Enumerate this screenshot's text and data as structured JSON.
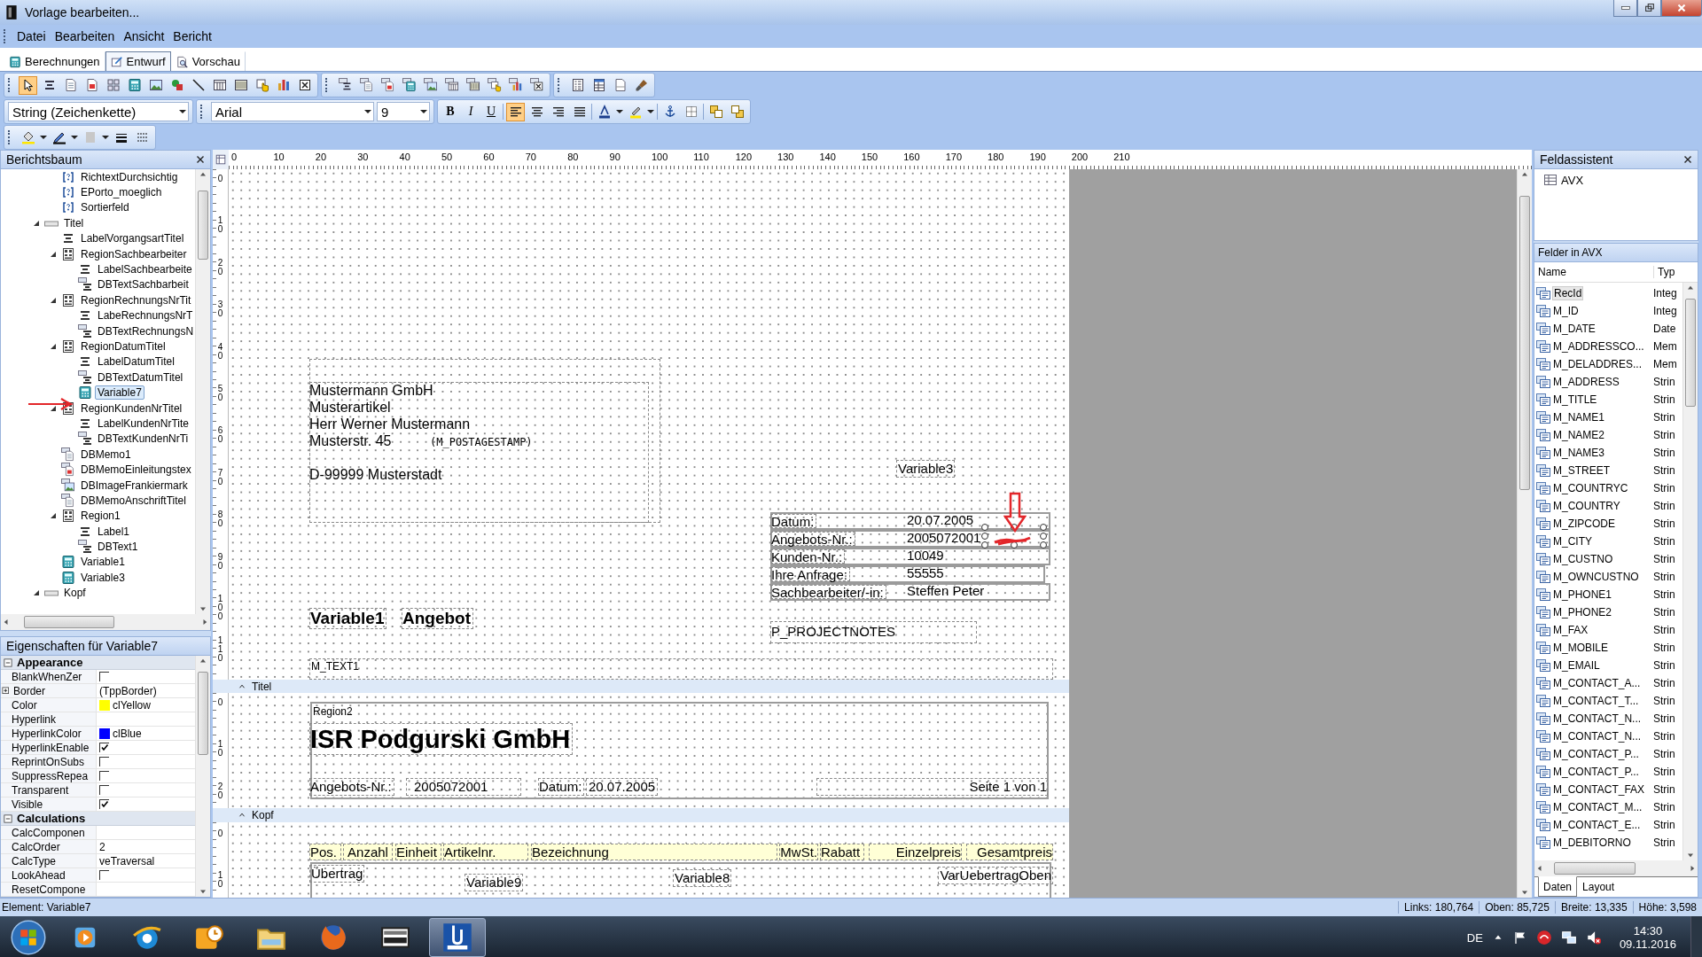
{
  "window": {
    "title": "Vorlage bearbeiten..."
  },
  "menu": [
    "Datei",
    "Bearbeiten",
    "Ansicht",
    "Bericht"
  ],
  "tabs": [
    {
      "label": "Berechnungen",
      "kind": "calc",
      "selected": false
    },
    {
      "label": "Entwurf",
      "kind": "design",
      "selected": true
    },
    {
      "label": "Vorschau",
      "kind": "preview",
      "selected": false
    }
  ],
  "toolbar": {
    "tools": [
      {
        "kind": "pointer",
        "selected": true
      },
      {
        "kind": "label",
        "selected": false
      },
      {
        "kind": "memo",
        "selected": false
      },
      {
        "kind": "richtext",
        "selected": false
      },
      {
        "kind": "sysvar",
        "selected": false
      },
      {
        "kind": "variable",
        "selected": false
      },
      {
        "kind": "image",
        "selected": false
      },
      {
        "kind": "shape",
        "selected": false
      },
      {
        "kind": "line",
        "selected": false
      },
      {
        "kind": "region",
        "selected": false
      },
      {
        "kind": "barcode",
        "selected": false
      },
      {
        "kind": "hand",
        "selected": false
      },
      {
        "kind": "chart",
        "selected": false
      },
      {
        "kind": "subreport",
        "selected": false
      },
      {
        "kind": "db-label",
        "selected": false
      },
      {
        "kind": "db-memo",
        "selected": false
      },
      {
        "kind": "db-richtext",
        "selected": false
      },
      {
        "kind": "db-variable",
        "selected": false
      },
      {
        "kind": "db-image",
        "selected": false
      },
      {
        "kind": "db-region",
        "selected": false
      },
      {
        "kind": "db-barcode",
        "selected": false
      },
      {
        "kind": "db-hand",
        "selected": false
      },
      {
        "kind": "db-chart",
        "selected": false
      },
      {
        "kind": "db-subreport",
        "selected": false
      },
      {
        "kind": "list",
        "selected": false
      },
      {
        "kind": "table",
        "selected": false
      },
      {
        "kind": "page",
        "selected": false
      },
      {
        "kind": "brush",
        "selected": false
      }
    ]
  },
  "format_bar": {
    "field_type": "String (Zeichenkette)",
    "font": "Arial",
    "font_size": "9",
    "styles": [
      {
        "label": "B",
        "kind": "bold"
      },
      {
        "label": "I",
        "kind": "italic"
      },
      {
        "label": "U",
        "kind": "underline"
      }
    ],
    "align": [
      {
        "kind": "left",
        "selected": true
      },
      {
        "kind": "center",
        "selected": false
      },
      {
        "kind": "right",
        "selected": false
      },
      {
        "kind": "justify",
        "selected": false
      }
    ]
  },
  "report_tree": {
    "title": "Berichtsbaum",
    "continued": [
      {
        "label": "RichtextDurchsichtig",
        "kind": "field",
        "selected": false
      },
      {
        "label": "EPorto_moeglich",
        "kind": "field",
        "selected": false
      },
      {
        "label": "Sortierfeld",
        "kind": "field",
        "selected": false
      }
    ],
    "nodes": [
      {
        "label": "Titel",
        "kind": "band",
        "selected": false,
        "expanded": true,
        "children": [
          {
            "label": "LabelVorgangsartTitel",
            "kind": "label",
            "selected": false
          },
          {
            "label": "RegionSachbearbeiter",
            "kind": "region",
            "selected": false,
            "expanded": true,
            "children": [
              {
                "label": "LabelSachbearbeite",
                "kind": "label",
                "selected": false
              },
              {
                "label": "DBTextSachbarbeit",
                "kind": "dbtext",
                "selected": false
              }
            ]
          },
          {
            "label": "RegionRechnungsNrTit",
            "kind": "region",
            "selected": false,
            "expanded": true,
            "children": [
              {
                "label": "LabeRechnungsNrT",
                "kind": "label",
                "selected": false
              },
              {
                "label": "DBTextRechnungsN",
                "kind": "dbtext",
                "selected": false
              }
            ]
          },
          {
            "label": "RegionDatumTitel",
            "kind": "region",
            "selected": false,
            "expanded": true,
            "children": [
              {
                "label": "LabelDatumTitel",
                "kind": "label",
                "selected": false
              },
              {
                "label": "DBTextDatumTitel",
                "kind": "dbtext",
                "selected": false
              },
              {
                "label": "Variable7",
                "kind": "variable",
                "selected": true
              }
            ]
          },
          {
            "label": "RegionKundenNrTitel",
            "kind": "region",
            "selected": false,
            "expanded": true,
            "children": [
              {
                "label": "LabelKundenNrTite",
                "kind": "label",
                "selected": false
              },
              {
                "label": "DBTextKundenNrTi",
                "kind": "dbtext",
                "selected": false
              }
            ]
          },
          {
            "label": "DBMemo1",
            "kind": "dbmemo",
            "selected": false
          },
          {
            "label": "DBMemoEinleitungstex",
            "kind": "dbrich",
            "selected": false
          },
          {
            "label": "DBImageFrankiermark",
            "kind": "dbimage",
            "selected": false
          },
          {
            "label": "DBMemoAnschriftTitel",
            "kind": "dbmemo",
            "selected": false
          },
          {
            "label": "Region1",
            "kind": "region",
            "selected": false,
            "expanded": true,
            "children": [
              {
                "label": "Label1",
                "kind": "label",
                "selected": false
              },
              {
                "label": "DBText1",
                "kind": "dbtext",
                "selected": false
              }
            ]
          },
          {
            "label": "Variable1",
            "kind": "variable",
            "selected": false
          },
          {
            "label": "Variable3",
            "kind": "variable",
            "selected": false
          }
        ]
      },
      {
        "label": "Kopf",
        "kind": "band",
        "selected": false,
        "expanded": true
      }
    ]
  },
  "properties": {
    "title": "Eigenschaften für Variable7",
    "categories": [
      {
        "name": "Appearance",
        "expanded": true,
        "rows": [
          {
            "name": "BlankWhenZer",
            "kind": "checkbox",
            "checked": false
          },
          {
            "name": "Border",
            "kind": "text",
            "value": "(TppBorder)",
            "expanded": false
          },
          {
            "name": "Color",
            "kind": "color",
            "value": "clYellow",
            "color": "#ffff00"
          },
          {
            "name": "Hyperlink",
            "kind": "text"
          },
          {
            "name": "HyperlinkColor",
            "kind": "color",
            "value": "clBlue",
            "color": "#0000ff"
          },
          {
            "name": "HyperlinkEnable",
            "kind": "checkbox",
            "checked": true
          },
          {
            "name": "ReprintOnSubs",
            "kind": "checkbox",
            "checked": false
          },
          {
            "name": "SuppressRepea",
            "kind": "checkbox",
            "checked": false
          },
          {
            "name": "Transparent",
            "kind": "checkbox",
            "checked": false
          },
          {
            "name": "Visible",
            "kind": "checkbox",
            "checked": true
          }
        ]
      },
      {
        "name": "Calculations",
        "expanded": true,
        "rows": [
          {
            "name": "CalcComponen",
            "kind": "text"
          },
          {
            "name": "CalcOrder",
            "kind": "text",
            "value": "2"
          },
          {
            "name": "CalcType",
            "kind": "text",
            "value": "veTraversal"
          },
          {
            "name": "LookAhead",
            "kind": "checkbox",
            "checked": false
          },
          {
            "name": "ResetCompone",
            "kind": "text"
          }
        ]
      }
    ]
  },
  "canvas": {
    "ruler": [
      "0",
      "10",
      "20",
      "30",
      "40",
      "50",
      "60",
      "70",
      "80",
      "90",
      "100",
      "110",
      "120",
      "130",
      "140",
      "150",
      "160",
      "170",
      "180",
      "190",
      "200",
      "210"
    ],
    "upper_band": {
      "ruler": [
        "0",
        "10",
        "20",
        "30",
        "40",
        "50",
        "60",
        "70",
        "80",
        "90",
        "100",
        "110"
      ],
      "address_lines": [
        "Mustermann GmbH",
        "Musterartikel",
        "Herr Werner Mustermann",
        "Musterstr. 45",
        "D-99999 Musterstadt"
      ],
      "postage_field": "(M_POSTAGESTAMP)",
      "variable_field": "Variable3",
      "info_rows": [
        {
          "label": "Datum:",
          "value": "20.07.2005"
        },
        {
          "label": "Angebots-Nr.:",
          "value": "2005072001"
        },
        {
          "label": "Kunden-Nr.:",
          "value": "10049"
        },
        {
          "label": "Ihre Anfrage:",
          "value": "55555"
        },
        {
          "label": "Sachbearbeiter/-in:",
          "value": "Steffen Peter"
        }
      ],
      "overlapping_fields": [
        "Variable1",
        "Angebot"
      ],
      "project_notes": "P_PROJECTNOTES",
      "memo_field": "M_TEXT1"
    },
    "title_band": {
      "name": "Titel",
      "ruler": [
        "0",
        "10",
        "20"
      ],
      "region_label": "Region2",
      "company": "ISR Podgurski GmbH",
      "offer_label": "Angebots-Nr.:",
      "offer_number": "2005072001",
      "date_label": "Datum:",
      "date": "20.07.2005",
      "page_info": "Seite 1 von 1"
    },
    "header_band": {
      "name": "Kopf",
      "ruler": [
        "0",
        "10"
      ],
      "columns": [
        {
          "label": "Pos.",
          "kind": "left"
        },
        {
          "label": "Anzahl",
          "kind": "center"
        },
        {
          "label": "Einheit",
          "kind": "left"
        },
        {
          "label": "Artikelnr.",
          "kind": "left"
        },
        {
          "label": "Bezeichnung",
          "kind": "left"
        },
        {
          "label": "MwSt.",
          "kind": "right"
        },
        {
          "label": "Rabatt",
          "kind": "left"
        },
        {
          "label": "Einzelpreis",
          "kind": "right"
        },
        {
          "label": "Gesamtpreis",
          "kind": "right"
        }
      ],
      "row_fields": [
        "Übertrag",
        "Variable9",
        "Variable8",
        "VarUebertragOben"
      ]
    }
  },
  "field_assistant": {
    "title": "Feldassistent",
    "source": "AVX",
    "fields_title": "Felder in AVX",
    "columns": [
      "Name",
      "Typ"
    ],
    "fields": [
      {
        "name": "RecId",
        "type": "Integ",
        "selected": true
      },
      {
        "name": "M_ID",
        "type": "Integ",
        "selected": false
      },
      {
        "name": "M_DATE",
        "type": "Date",
        "selected": false
      },
      {
        "name": "M_ADDRESSCO...",
        "type": "Mem",
        "selected": false
      },
      {
        "name": "M_DELADDRES...",
        "type": "Mem",
        "selected": false
      },
      {
        "name": "M_ADDRESS",
        "type": "Strin",
        "selected": false
      },
      {
        "name": "M_TITLE",
        "type": "Strin",
        "selected": false
      },
      {
        "name": "M_NAME1",
        "type": "Strin",
        "selected": false
      },
      {
        "name": "M_NAME2",
        "type": "Strin",
        "selected": false
      },
      {
        "name": "M_NAME3",
        "type": "Strin",
        "selected": false
      },
      {
        "name": "M_STREET",
        "type": "Strin",
        "selected": false
      },
      {
        "name": "M_COUNTRYC",
        "type": "Strin",
        "selected": false
      },
      {
        "name": "M_COUNTRY",
        "type": "Strin",
        "selected": false
      },
      {
        "name": "M_ZIPCODE",
        "type": "Strin",
        "selected": false
      },
      {
        "name": "M_CITY",
        "type": "Strin",
        "selected": false
      },
      {
        "name": "M_CUSTNO",
        "type": "Strin",
        "selected": false
      },
      {
        "name": "M_OWNCUSTNO",
        "type": "Strin",
        "selected": false
      },
      {
        "name": "M_PHONE1",
        "type": "Strin",
        "selected": false
      },
      {
        "name": "M_PHONE2",
        "type": "Strin",
        "selected": false
      },
      {
        "name": "M_FAX",
        "type": "Strin",
        "selected": false
      },
      {
        "name": "M_MOBILE",
        "type": "Strin",
        "selected": false
      },
      {
        "name": "M_EMAIL",
        "type": "Strin",
        "selected": false
      },
      {
        "name": "M_CONTACT_A...",
        "type": "Strin",
        "selected": false
      },
      {
        "name": "M_CONTACT_T...",
        "type": "Strin",
        "selected": false
      },
      {
        "name": "M_CONTACT_N...",
        "type": "Strin",
        "selected": false
      },
      {
        "name": "M_CONTACT_N...",
        "type": "Strin",
        "selected": false
      },
      {
        "name": "M_CONTACT_P...",
        "type": "Strin",
        "selected": false
      },
      {
        "name": "M_CONTACT_P...",
        "type": "Strin",
        "selected": false
      },
      {
        "name": "M_CONTACT_FAX",
        "type": "Strin",
        "selected": false
      },
      {
        "name": "M_CONTACT_M...",
        "type": "Strin",
        "selected": false
      },
      {
        "name": "M_CONTACT_E...",
        "type": "Strin",
        "selected": false
      },
      {
        "name": "M_DEBITORNO",
        "type": "Strin",
        "selected": false
      }
    ],
    "tabs": [
      {
        "label": "Daten",
        "selected": true
      },
      {
        "label": "Layout",
        "selected": false
      }
    ]
  },
  "status_bar": {
    "element": "Element: Variable7",
    "fields": [
      "Links: 180,764",
      "Oben: 85,725",
      "Breite: 13,335",
      "Höhe: 3,598"
    ]
  },
  "taskbar": {
    "apps": [
      {
        "kind": "media",
        "selected": false
      },
      {
        "kind": "ie",
        "selected": false
      },
      {
        "kind": "outlook",
        "selected": false
      },
      {
        "kind": "explorer",
        "selected": false
      },
      {
        "kind": "firefox",
        "selected": false
      },
      {
        "kind": "crypto",
        "selected": false
      },
      {
        "kind": "om",
        "selected": true
      }
    ],
    "language": "DE",
    "time": "14:30",
    "date": "09.11.2016"
  }
}
